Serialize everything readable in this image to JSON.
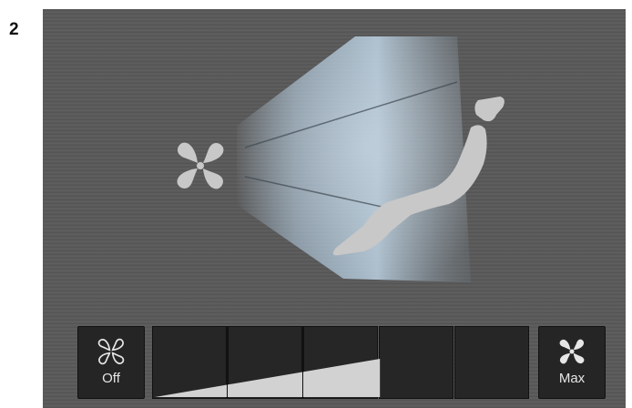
{
  "figure": {
    "number": "2"
  },
  "controls": {
    "off_label": "Off",
    "max_label": "Max",
    "off_icon": "fan-outline-icon",
    "max_icon": "fan-filled-icon"
  },
  "fan_speed": {
    "segments_total": 5,
    "level_fraction": 0.6
  },
  "colors": {
    "screen_background": "#5b5b5b",
    "airflow": "#a9c3d8",
    "seat": "#c8c8c8",
    "fan_icon": "#c8c8c8",
    "button_background": "#252525",
    "level_fill": "#d2d2d2"
  }
}
